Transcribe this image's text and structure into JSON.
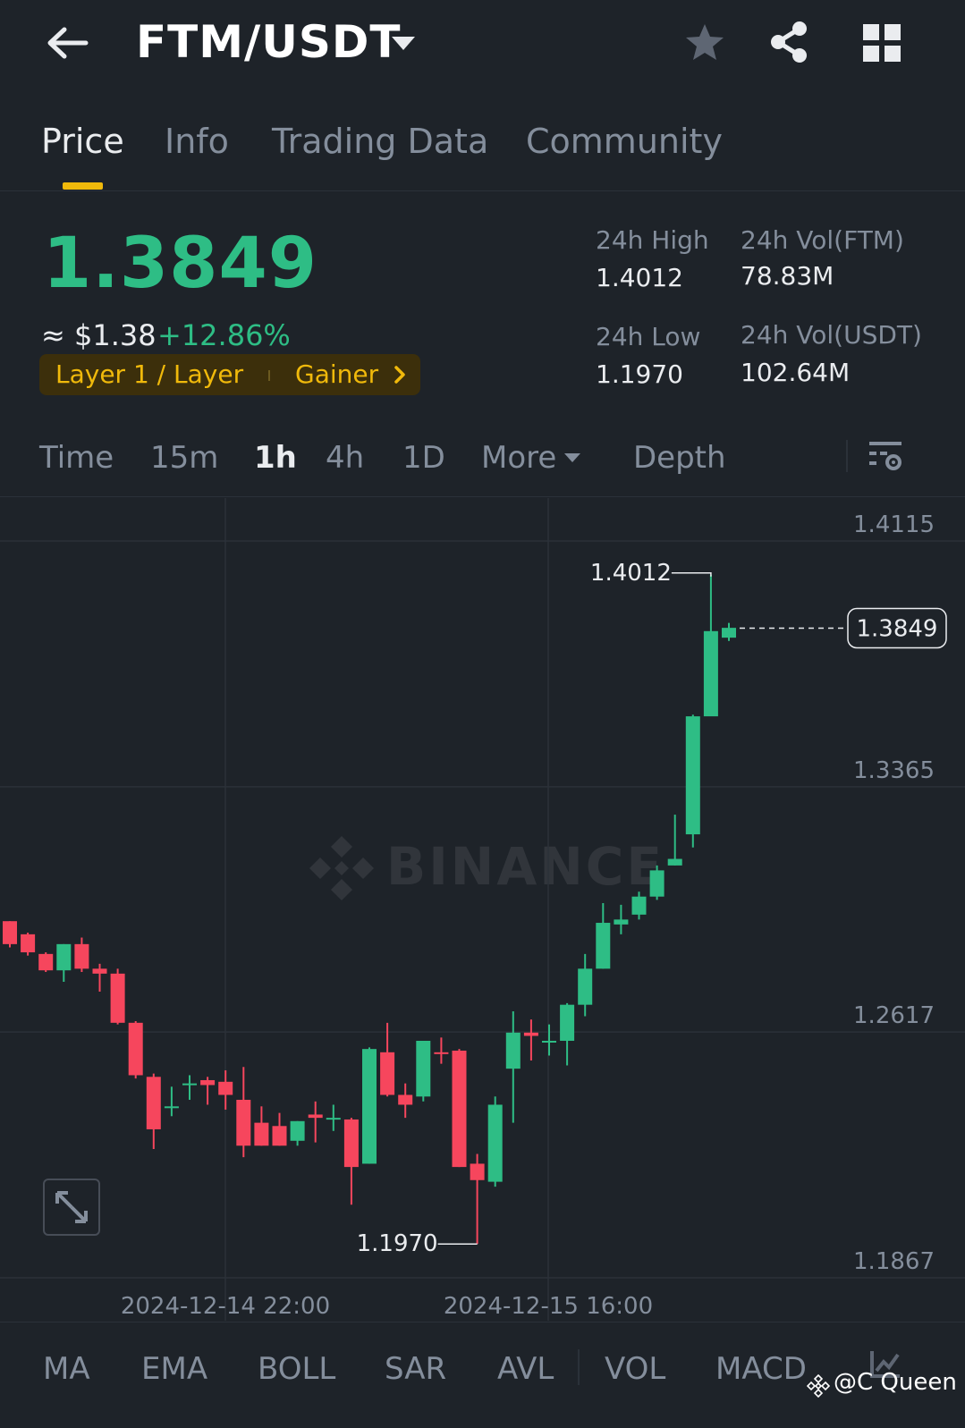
{
  "header": {
    "pair": "FTM/USDT"
  },
  "tabs": [
    "Price",
    "Info",
    "Trading Data",
    "Community"
  ],
  "price": {
    "last": "1.3849",
    "fiat": "≈ $1.38",
    "change": "+12.86%",
    "tag_category": "Layer 1 / Layer",
    "tag_rank": "Gainer"
  },
  "stats": {
    "high_label": "24h High",
    "high_value": "1.4012",
    "low_label": "24h Low",
    "low_value": "1.1970",
    "vol_ftm_label": "24h Vol(FTM)",
    "vol_ftm_value": "78.83M",
    "vol_usdt_label": "24h Vol(USDT)",
    "vol_usdt_value": "102.64M"
  },
  "intervals": {
    "time": "Time",
    "m15": "15m",
    "h1": "1h",
    "h4": "4h",
    "d1": "1D",
    "more": "More",
    "depth": "Depth"
  },
  "indicators": [
    "MA",
    "EMA",
    "BOLL",
    "SAR",
    "AVL",
    "VOL",
    "MACD"
  ],
  "overlay_text": "@C Queen",
  "colors": {
    "up": "#2ebd85",
    "down": "#f6465d",
    "accent": "#f0b90b",
    "background": "#1e2329"
  },
  "chart_data": {
    "type": "candlestick",
    "y_ticks": [
      "1.4115",
      "1.3365",
      "1.2617",
      "1.1867"
    ],
    "x_ticks": [
      "2024-12-14 22:00",
      "2024-12-15 16:00"
    ],
    "ylim": [
      1.1867,
      1.4115
    ],
    "high_label": "1.4012",
    "low_label": "1.1970",
    "last_price_label": "1.3849",
    "candles": [
      {
        "o": 1.2955,
        "h": 1.2955,
        "c": 1.2885,
        "l": 1.2875
      },
      {
        "o": 1.2915,
        "h": 1.292,
        "c": 1.286,
        "l": 1.285
      },
      {
        "o": 1.2855,
        "h": 1.286,
        "c": 1.2805,
        "l": 1.28
      },
      {
        "o": 1.2805,
        "h": 1.2885,
        "c": 1.2885,
        "l": 1.277
      },
      {
        "o": 1.2885,
        "h": 1.2905,
        "c": 1.281,
        "l": 1.28
      },
      {
        "o": 1.281,
        "h": 1.2825,
        "c": 1.2795,
        "l": 1.274
      },
      {
        "o": 1.2795,
        "h": 1.281,
        "c": 1.2645,
        "l": 1.264
      },
      {
        "o": 1.2645,
        "h": 1.265,
        "c": 1.2485,
        "l": 1.2475
      },
      {
        "o": 1.248,
        "h": 1.249,
        "c": 1.232,
        "l": 1.226
      },
      {
        "o": 1.239,
        "h": 1.245,
        "c": 1.239,
        "l": 1.236
      },
      {
        "o": 1.2455,
        "h": 1.2485,
        "c": 1.246,
        "l": 1.241
      },
      {
        "o": 1.247,
        "h": 1.248,
        "c": 1.2455,
        "l": 1.2395
      },
      {
        "o": 1.2465,
        "h": 1.25,
        "c": 1.2425,
        "l": 1.238
      },
      {
        "o": 1.241,
        "h": 1.251,
        "c": 1.227,
        "l": 1.2235
      },
      {
        "o": 1.234,
        "h": 1.239,
        "c": 1.227,
        "l": 1.227
      },
      {
        "o": 1.233,
        "h": 1.237,
        "c": 1.227,
        "l": 1.227
      },
      {
        "o": 1.2285,
        "h": 1.2345,
        "c": 1.2345,
        "l": 1.227
      },
      {
        "o": 1.2365,
        "h": 1.2405,
        "c": 1.2355,
        "l": 1.228
      },
      {
        "o": 1.2355,
        "h": 1.2395,
        "c": 1.2355,
        "l": 1.2315
      },
      {
        "o": 1.235,
        "h": 1.2355,
        "c": 1.2205,
        "l": 1.209
      },
      {
        "o": 1.2215,
        "h": 1.257,
        "c": 1.2565,
        "l": 1.2215
      },
      {
        "o": 1.2555,
        "h": 1.2645,
        "c": 1.2425,
        "l": 1.242
      },
      {
        "o": 1.2425,
        "h": 1.246,
        "c": 1.2395,
        "l": 1.2355
      },
      {
        "o": 1.242,
        "h": 1.259,
        "c": 1.259,
        "l": 1.2405
      },
      {
        "o": 1.2555,
        "h": 1.26,
        "c": 1.255,
        "l": 1.252
      },
      {
        "o": 1.256,
        "h": 1.2565,
        "c": 1.2205,
        "l": 1.2205
      },
      {
        "o": 1.2215,
        "h": 1.2245,
        "c": 1.2165,
        "l": 1.197
      },
      {
        "o": 1.216,
        "h": 1.242,
        "c": 1.2395,
        "l": 1.2145
      },
      {
        "o": 1.2505,
        "h": 1.268,
        "c": 1.2615,
        "l": 1.234
      },
      {
        "o": 1.2615,
        "h": 1.2655,
        "c": 1.2605,
        "l": 1.253
      },
      {
        "o": 1.2585,
        "h": 1.264,
        "c": 1.259,
        "l": 1.2545
      },
      {
        "o": 1.259,
        "h": 1.2705,
        "c": 1.27,
        "l": 1.2515
      },
      {
        "o": 1.27,
        "h": 1.2855,
        "c": 1.281,
        "l": 1.2665
      },
      {
        "o": 1.281,
        "h": 1.301,
        "c": 1.295,
        "l": 1.281
      },
      {
        "o": 1.2945,
        "h": 1.3005,
        "c": 1.296,
        "l": 1.2915
      },
      {
        "o": 1.2975,
        "h": 1.3045,
        "c": 1.303,
        "l": 1.296
      },
      {
        "o": 1.303,
        "h": 1.3125,
        "c": 1.311,
        "l": 1.302
      },
      {
        "o": 1.3125,
        "h": 1.328,
        "c": 1.3145,
        "l": 1.3125
      },
      {
        "o": 1.322,
        "h": 1.3585,
        "c": 1.358,
        "l": 1.318
      },
      {
        "o": 1.358,
        "h": 1.4012,
        "c": 1.384,
        "l": 1.3815
      },
      {
        "o": 1.382,
        "h": 1.3865,
        "c": 1.385,
        "l": 1.381
      }
    ]
  }
}
